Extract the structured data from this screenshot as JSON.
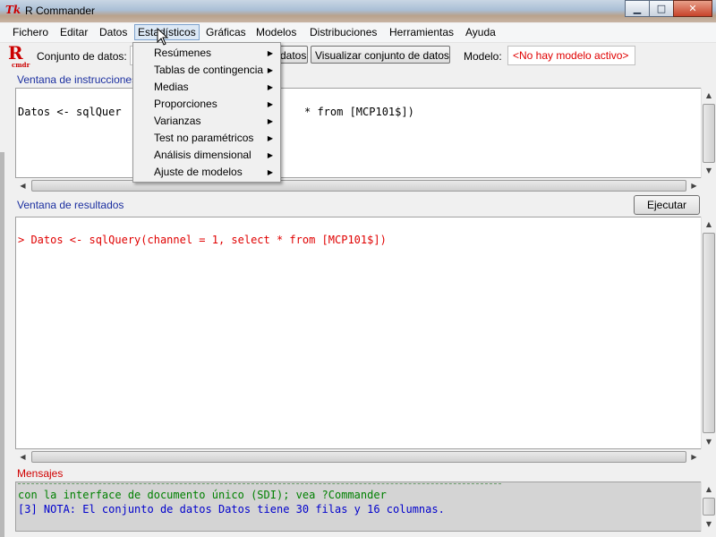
{
  "window": {
    "app_icon": "Tk",
    "title": "R Commander",
    "controls": {
      "minimize": "minimize-icon",
      "maximize": "maximize-icon",
      "close": "close-icon"
    }
  },
  "menu": {
    "items": [
      "Fichero",
      "Editar",
      "Datos",
      "Estadísticos",
      "Gráficas",
      "Modelos",
      "Distribuciones",
      "Herramientas",
      "Ayuda"
    ],
    "active": "Estadísticos"
  },
  "toolbar": {
    "logo_letter": "R",
    "logo_sub": "cmdr",
    "dataset_label": "Conjunto de datos:",
    "edit_button": "datos",
    "view_button": "Visualizar conjunto de datos",
    "model_label": "Modelo:",
    "model_value": "<No hay modelo activo>"
  },
  "stats_menu": {
    "items": [
      "Resúmenes",
      "Tablas de contingencia",
      "Medias",
      "Proporciones",
      "Varianzas",
      "Test no paramétricos",
      "Análisis dimensional",
      "Ajuste de modelos"
    ]
  },
  "script_window": {
    "label": "Ventana de instrucciones",
    "line_visible_start": "Datos <- sqlQuer",
    "line_visible_end": "* from [MCP101$])"
  },
  "output_window": {
    "label": "Ventana de resultados",
    "execute_button": "Ejecutar",
    "line": "> Datos <- sqlQuery(channel = 1, select * from [MCP101$])"
  },
  "messages": {
    "label": "Mensajes",
    "lines": [
      "con la interface de documento único (SDI); vea ?Commander",
      "[3] NOTA: El conjunto de datos Datos tiene 30 filas y 16 columnas."
    ]
  },
  "colors": {
    "output_text": "#e00000",
    "message_text": "#008000",
    "note_text": "#0000cc",
    "label_blue": "#1b2fa0",
    "label_red": "#d00000"
  }
}
